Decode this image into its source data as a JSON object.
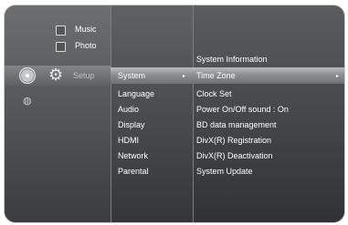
{
  "main_menu": {
    "items": [
      {
        "label": "Music",
        "icon": "music-icon"
      },
      {
        "label": "Photo",
        "icon": "photo-icon"
      },
      {
        "label": "Setup",
        "icon": "gear-icon"
      }
    ],
    "extra_icons": [
      "disc-icon",
      "globe-icon"
    ]
  },
  "setup_menu": {
    "items": [
      "System",
      "Language",
      "Audio",
      "Display",
      "HDMI",
      "Network",
      "Parental"
    ],
    "selected": "System"
  },
  "system_menu": {
    "title": "System Information",
    "items": [
      "Time Zone",
      "Clock Set",
      "Power On/Off sound   : On",
      "BD data management",
      "DivX(R) Registration",
      "DivX(R) Deactivation",
      "System Update"
    ],
    "selected": "Time Zone"
  },
  "colors": {
    "highlight": "#9c9ea1",
    "text": "#ffffff"
  }
}
